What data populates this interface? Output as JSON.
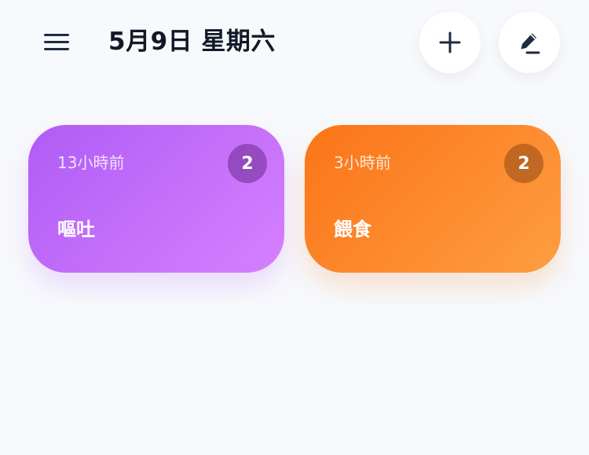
{
  "header": {
    "title": "5月9日 星期六",
    "menu_icon": "hamburger-menu-icon",
    "add_icon": "plus-icon",
    "edit_icon": "pencil-icon"
  },
  "cards": [
    {
      "time_ago": "13小時前",
      "count": "2",
      "label": "嘔吐",
      "color_start": "#b05cf6",
      "color_end": "#d680fe"
    },
    {
      "time_ago": "3小時前",
      "count": "2",
      "label": "餵食",
      "color_start": "#fb7417",
      "color_end": "#fe9d42"
    }
  ],
  "colors": {
    "background": "#f7f9fc",
    "title_text": "#111827",
    "icon": "#1f2a44"
  }
}
